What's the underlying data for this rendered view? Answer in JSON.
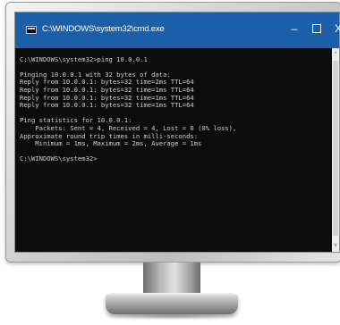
{
  "window": {
    "title": "C:\\WINDOWS\\system32\\cmd.exe",
    "minimize_glyph": "–",
    "close_glyph": "X",
    "app_icon": "cmd-icon"
  },
  "console": {
    "lines": [
      "",
      "C:\\WINDOWS\\system32>ping 10.0.0.1",
      "",
      "Pinging 10.0.0.1 with 32 bytes of data:",
      "Reply from 10.0.0.1: bytes=32 time=2ms TTL=64",
      "Reply from 10.0.0.1: bytes=32 time=1ms TTL=64",
      "Reply from 10.0.0.1: bytes=32 time=1ms TTL=64",
      "Reply from 10.0.0.1: bytes=32 time=1ms TTL=64",
      "",
      "Ping statistics for 10.0.0.1:",
      "    Packets: Sent = 4, Received = 4, Lost = 0 (0% loss),",
      "Approximate round trip times in milli-seconds:",
      "    Minimum = 1ms, Maximum = 2ms, Average = 1ms",
      "",
      "C:\\WINDOWS\\system32>"
    ]
  },
  "scrollbar": {
    "up_glyph": "^",
    "down_glyph": "v"
  },
  "colors": {
    "titlebar": "#1b5fa8",
    "console_bg": "#0c0c0c",
    "console_text": "#cfcfcf"
  }
}
